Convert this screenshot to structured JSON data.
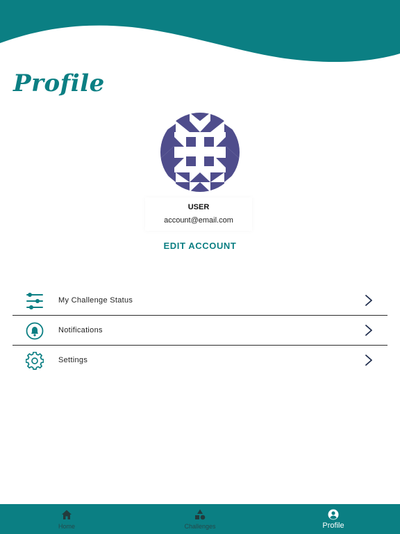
{
  "header": {
    "title": "Profile"
  },
  "profile": {
    "username": "USER",
    "email": "account@email.com",
    "edit_label": "EDIT ACCOUNT",
    "avatar_icon": "identicon-avatar"
  },
  "menu": {
    "items": [
      {
        "label": "My Challenge Status",
        "icon": "sliders-icon"
      },
      {
        "label": "Notifications",
        "icon": "bell-icon"
      },
      {
        "label": "Settings",
        "icon": "gear-icon"
      }
    ]
  },
  "tabbar": {
    "tabs": [
      {
        "label": "Home",
        "icon": "home-icon",
        "active": false
      },
      {
        "label": "Challenges",
        "icon": "shapes-icon",
        "active": false
      },
      {
        "label": "Profile",
        "icon": "user-circle-icon",
        "active": true
      }
    ]
  },
  "colors": {
    "accent": "#0b7f83",
    "avatar": "#4f4d8c",
    "divider": "#2b2b2b",
    "inactive_tab_text": "#25494b"
  }
}
